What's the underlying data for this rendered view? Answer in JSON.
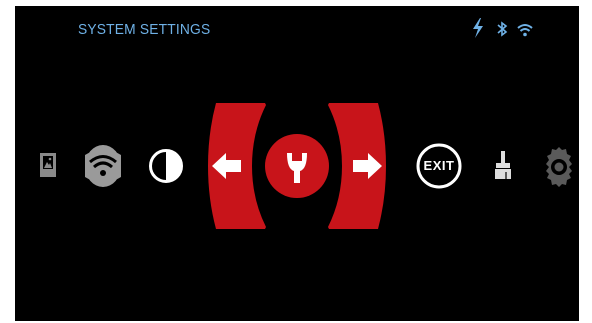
{
  "header": {
    "title": "SYSTEM SETTINGS",
    "status_icons": [
      "charging-icon",
      "bluetooth-icon",
      "wifi-icon"
    ]
  },
  "menu": {
    "items": [
      {
        "icon": "gallery-icon",
        "selected": false
      },
      {
        "icon": "wifi-icon",
        "selected": false
      },
      {
        "icon": "contrast-icon",
        "selected": false
      },
      {
        "icon": "arrow-left-icon",
        "selected": false
      },
      {
        "icon": "wrench-icon",
        "selected": true
      },
      {
        "icon": "arrow-right-icon",
        "selected": false
      },
      {
        "icon": "exit-icon",
        "label": "EXIT",
        "selected": false
      },
      {
        "icon": "brush-icon",
        "selected": false
      },
      {
        "icon": "gear-icon",
        "selected": false
      }
    ]
  },
  "colors": {
    "accent": "#c8141a",
    "header_text": "#6fb1e6",
    "background": "#000000",
    "icon": "#ffffff",
    "icon_dim": "#9a9a9a"
  }
}
